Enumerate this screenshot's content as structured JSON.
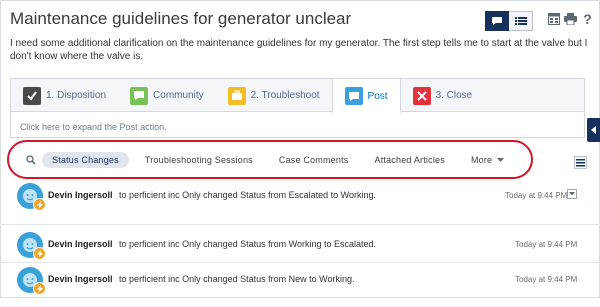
{
  "header": {
    "title": "Maintenance guidelines for generator unclear",
    "description": "I need some additional clarification on the maintenance guidelines for my generator. The first step tells me to start at the valve but I don't know where the valve is."
  },
  "actions": {
    "tabs": [
      {
        "label": "1. Disposition",
        "icon": "checkbox-icon",
        "color": "#4a4a4a"
      },
      {
        "label": "Community",
        "icon": "chat-icon",
        "color": "#7bc15a"
      },
      {
        "label": "2. Troubleshoot",
        "icon": "briefcase-icon",
        "color": "#f4bc25"
      },
      {
        "label": "Post",
        "icon": "post-icon",
        "color": "#3ba0e0",
        "active": true
      },
      {
        "label": "3. Close",
        "icon": "close-icon",
        "color": "#e2333a"
      }
    ],
    "expand_hint": "Click here to expand the Post action."
  },
  "feed_filters": {
    "items": [
      "Status Changes",
      "Troubleshooting Sessions",
      "Case Comments",
      "Attached Articles"
    ],
    "more_label": "More"
  },
  "feed": [
    {
      "author": "Devin Ingersoll",
      "text": "to perficient inc Only changed Status from Escalated to Working.",
      "time": "Today at 9:44 PM",
      "has_menu": true
    },
    {
      "author": "Devin Ingersoll",
      "text": "to perficient inc Only changed Status from Working to Escalated.",
      "time": "Today at 9:44 PM",
      "has_menu": false
    },
    {
      "author": "Devin Ingersoll",
      "text": "to perficient inc Only changed Status from New to Working.",
      "time": "Today at 9:44 PM",
      "has_menu": false
    }
  ],
  "colors": {
    "accent": "#0070d2",
    "highlight": "#d5142a",
    "navy": "#16325c"
  }
}
